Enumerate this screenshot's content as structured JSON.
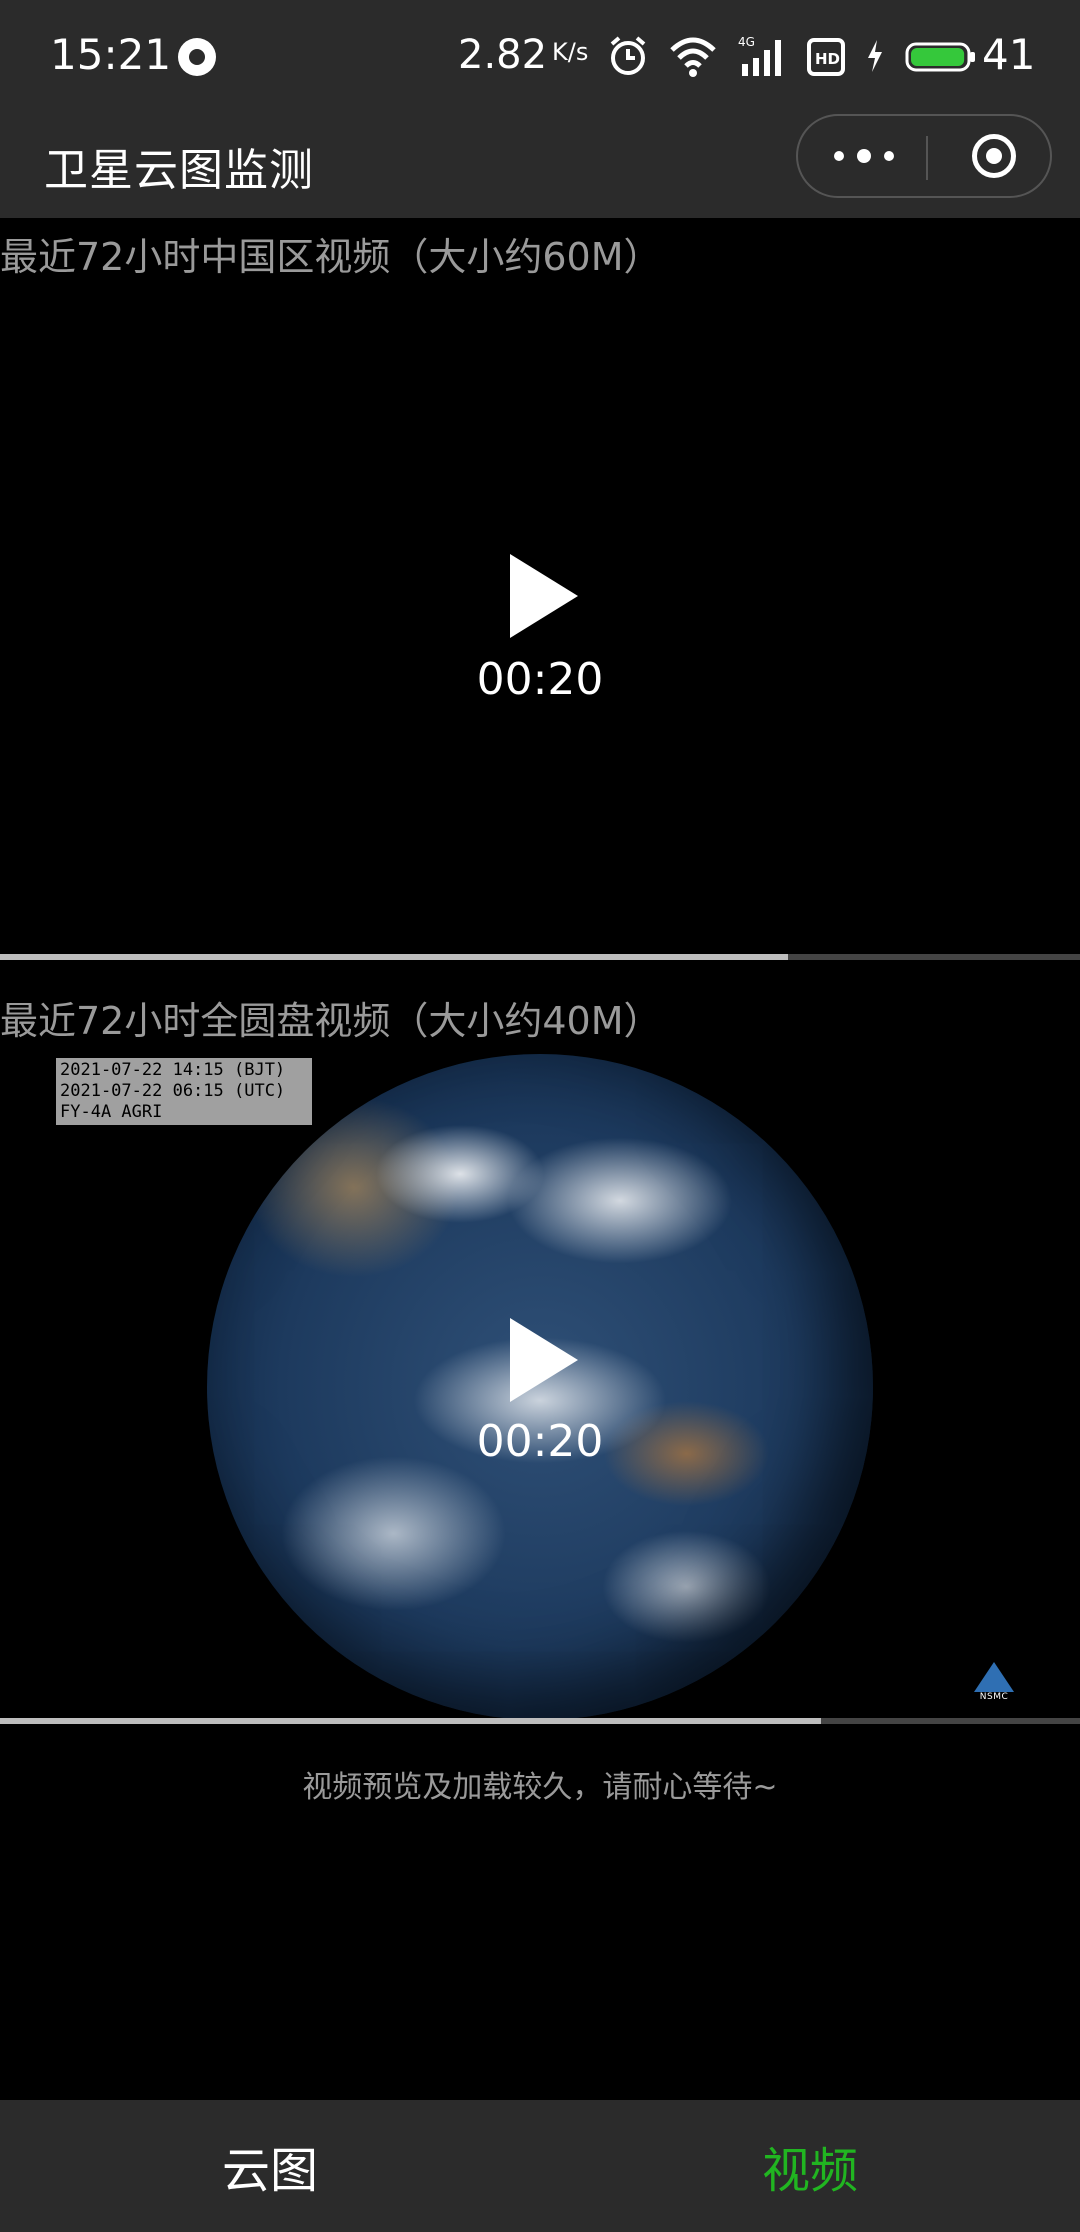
{
  "status_bar": {
    "time": "15:21",
    "net_speed": "2.82",
    "net_speed_unit": "K/s",
    "network_type": "4G",
    "hd_label": "HD",
    "battery_level": "41",
    "battery_color": "#35c83b"
  },
  "header": {
    "title": "卫星云图监测"
  },
  "videos": [
    {
      "title": "最近72小时中国区视频（大小约60M）",
      "duration": "00:20",
      "progress": 0.73
    },
    {
      "title": "最近72小时全圆盘视频（大小约40M）",
      "duration": "00:20",
      "progress": 0.76,
      "overlay_lines": [
        "2021-07-22 14:15 (BJT)",
        "2021-07-22 06:15 (UTC)",
        "FY-4A AGRI"
      ],
      "logo_text": "NSMC"
    }
  ],
  "hint": "视频预览及加载较久，请耐心等待~",
  "tabs": [
    {
      "label": "云图",
      "active": false,
      "color": "#ffffff"
    },
    {
      "label": "视频",
      "active": true,
      "color": "#21b521"
    }
  ]
}
